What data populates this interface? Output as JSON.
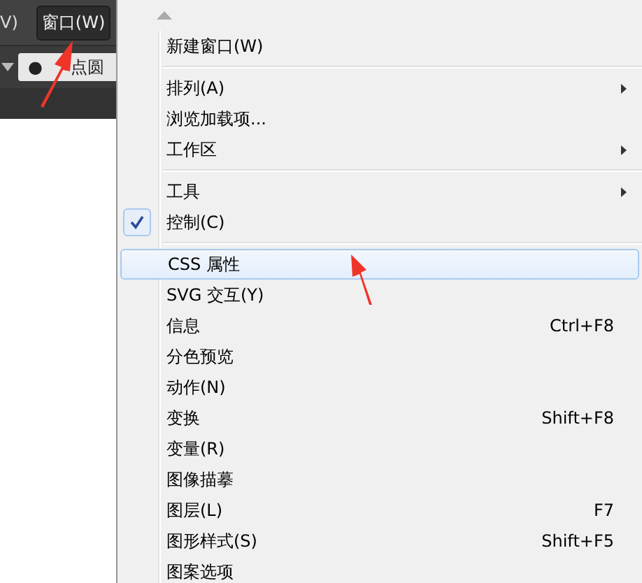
{
  "menubar": [
    {
      "label": "V)",
      "selected": false
    },
    {
      "label": "窗口(W)",
      "selected": true
    }
  ],
  "toolbar": {
    "bullet": "●",
    "value": "点圆"
  },
  "menu": {
    "items": [
      {
        "kind": "scroll-up"
      },
      {
        "kind": "item",
        "label": "新建窗口(W)",
        "submenu": false,
        "checked": false,
        "selected": false
      },
      {
        "kind": "separator"
      },
      {
        "kind": "item",
        "label": "排列(A)",
        "submenu": true,
        "checked": false,
        "selected": false
      },
      {
        "kind": "item",
        "label": "浏览加载项...",
        "submenu": false,
        "checked": false,
        "selected": false
      },
      {
        "kind": "item",
        "label": "工作区",
        "submenu": true,
        "checked": false,
        "selected": false
      },
      {
        "kind": "separator"
      },
      {
        "kind": "item",
        "label": "工具",
        "submenu": true,
        "checked": false,
        "selected": false
      },
      {
        "kind": "item",
        "label": "控制(C)",
        "submenu": false,
        "checked": true,
        "selected": false
      },
      {
        "kind": "separator"
      },
      {
        "kind": "item",
        "label": "CSS 属性",
        "submenu": false,
        "checked": false,
        "selected": true
      },
      {
        "kind": "item",
        "label": "SVG 交互(Y)",
        "submenu": false,
        "checked": false,
        "selected": false
      },
      {
        "kind": "item",
        "label": "信息",
        "shortcut": "Ctrl+F8",
        "submenu": false,
        "checked": false,
        "selected": false
      },
      {
        "kind": "item",
        "label": "分色预览",
        "submenu": false,
        "checked": false,
        "selected": false
      },
      {
        "kind": "item",
        "label": "动作(N)",
        "submenu": false,
        "checked": false,
        "selected": false
      },
      {
        "kind": "item",
        "label": "变换",
        "shortcut": "Shift+F8",
        "submenu": false,
        "checked": false,
        "selected": false
      },
      {
        "kind": "item",
        "label": "变量(R)",
        "submenu": false,
        "checked": false,
        "selected": false
      },
      {
        "kind": "item",
        "label": "图像描摹",
        "submenu": false,
        "checked": false,
        "selected": false
      },
      {
        "kind": "item",
        "label": "图层(L)",
        "shortcut": "F7",
        "submenu": false,
        "checked": false,
        "selected": false
      },
      {
        "kind": "item",
        "label": "图形样式(S)",
        "shortcut": "Shift+F5",
        "submenu": false,
        "checked": false,
        "selected": false
      },
      {
        "kind": "item",
        "label": "图案选项",
        "submenu": false,
        "checked": false,
        "selected": false
      }
    ]
  }
}
